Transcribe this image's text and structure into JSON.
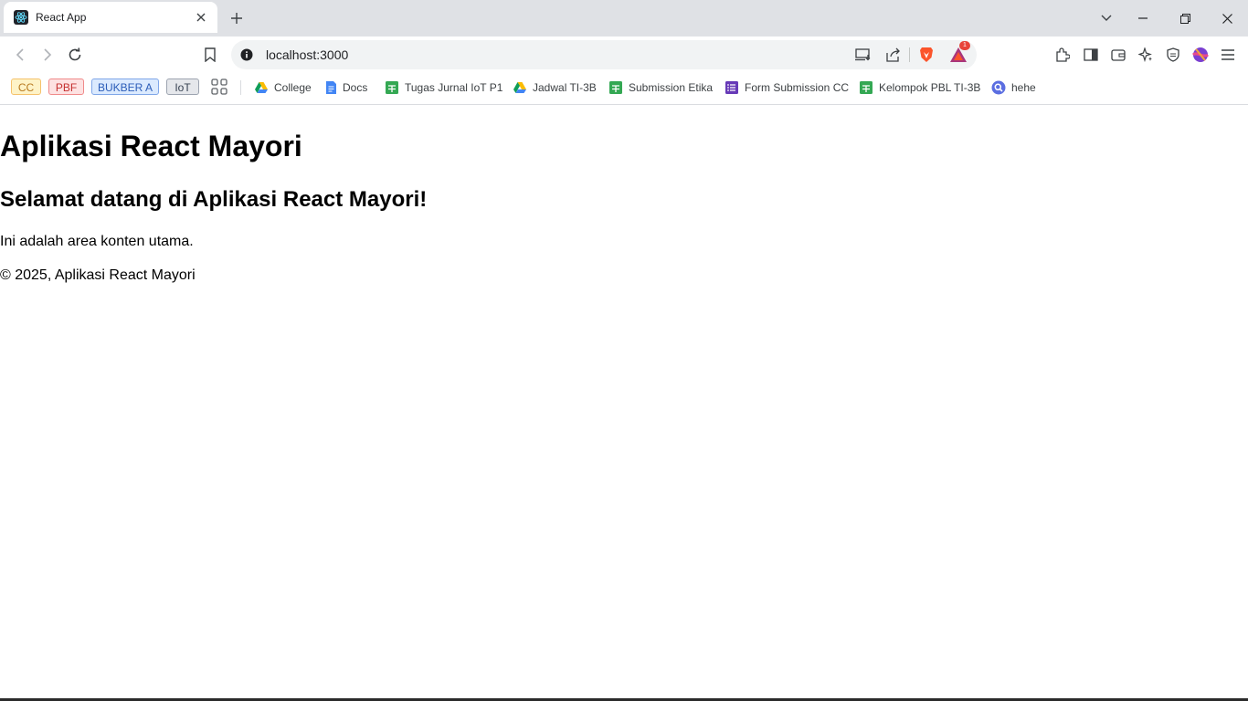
{
  "browser": {
    "tab": {
      "title": "React App",
      "favicon": "react-icon"
    },
    "toolbar": {
      "url": "localhost:3000",
      "notification_count": "1"
    },
    "bookmarks": {
      "chips": [
        {
          "label": "CC",
          "bg": "#fef3c7",
          "border": "#f5c26b",
          "color": "#b7791f"
        },
        {
          "label": "PBF",
          "bg": "#fde2e2",
          "border": "#f08a8a",
          "color": "#c53030"
        },
        {
          "label": "BUKBER A",
          "bg": "#dbeafe",
          "border": "#7fa6e8",
          "color": "#2b5cb8"
        },
        {
          "label": "IoT",
          "bg": "#e5e7eb",
          "border": "#9ca3af",
          "color": "#374151"
        }
      ],
      "items": [
        {
          "label": "College",
          "icon": "google-drive-icon"
        },
        {
          "label": "Docs",
          "icon": "google-docs-icon"
        },
        {
          "label": "Tugas Jurnal IoT P1",
          "icon": "google-sheets-icon"
        },
        {
          "label": "Jadwal TI-3B",
          "icon": "google-drive-icon"
        },
        {
          "label": "Submission Etika",
          "icon": "google-sheets-icon"
        },
        {
          "label": "Form Submission CC",
          "icon": "google-forms-icon"
        },
        {
          "label": "Kelompok PBL TI-3B",
          "icon": "google-sheets-icon"
        },
        {
          "label": "hehe",
          "icon": "search-icon"
        }
      ]
    }
  },
  "page": {
    "title": "Aplikasi React Mayori",
    "welcome": "Selamat datang di Aplikasi React Mayori!",
    "content": "Ini adalah area konten utama.",
    "footer": "© 2025, Aplikasi React Mayori"
  },
  "colors": {
    "tabstrip": "#dfe1e5",
    "omnibox": "#f1f3f4",
    "brave_orange": "#fb542b",
    "sheets_green": "#34a853",
    "forms_purple": "#673ab7",
    "docs_blue": "#4285f4"
  }
}
